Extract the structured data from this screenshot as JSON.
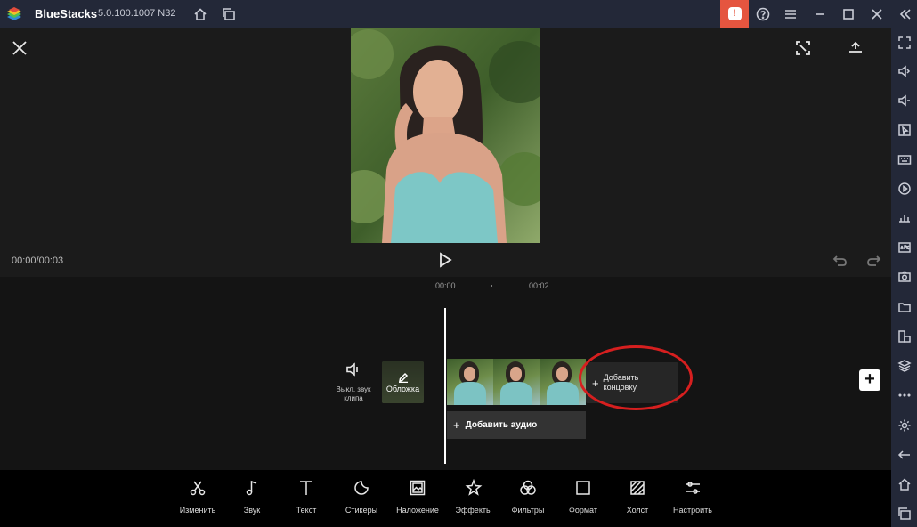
{
  "titlebar": {
    "app_name": "BlueStacks",
    "version": "5.0.100.1007 N32",
    "alert_glyph": "!"
  },
  "editor": {
    "time_readout": "00:00/00:03",
    "timeline_ticks": [
      "00:00",
      "00:02"
    ],
    "mute_label": "Выкл. звук клипа",
    "cover_label": "Обложка",
    "add_ending_label": "Добавить концовку",
    "add_audio_label": "Добавить аудио",
    "add_clip_glyph": "+"
  },
  "toolbar": {
    "items": [
      {
        "label": "Изменить",
        "icon": "scissors-icon"
      },
      {
        "label": "Звук",
        "icon": "music-note-icon"
      },
      {
        "label": "Текст",
        "icon": "text-icon"
      },
      {
        "label": "Стикеры",
        "icon": "sticker-icon"
      },
      {
        "label": "Наложение",
        "icon": "overlay-icon"
      },
      {
        "label": "Эффекты",
        "icon": "effects-star-icon"
      },
      {
        "label": "Фильтры",
        "icon": "filters-icon"
      },
      {
        "label": "Формат",
        "icon": "format-square-icon"
      },
      {
        "label": "Холст",
        "icon": "canvas-icon"
      },
      {
        "label": "Настроить",
        "icon": "adjust-sliders-icon"
      }
    ]
  },
  "colors": {
    "titlebar_bg": "#232838",
    "alert_bg": "#e5553f",
    "highlight": "#d61f1f",
    "editor_bg": "#1b1b1b",
    "toolbar_bg": "#000000"
  }
}
